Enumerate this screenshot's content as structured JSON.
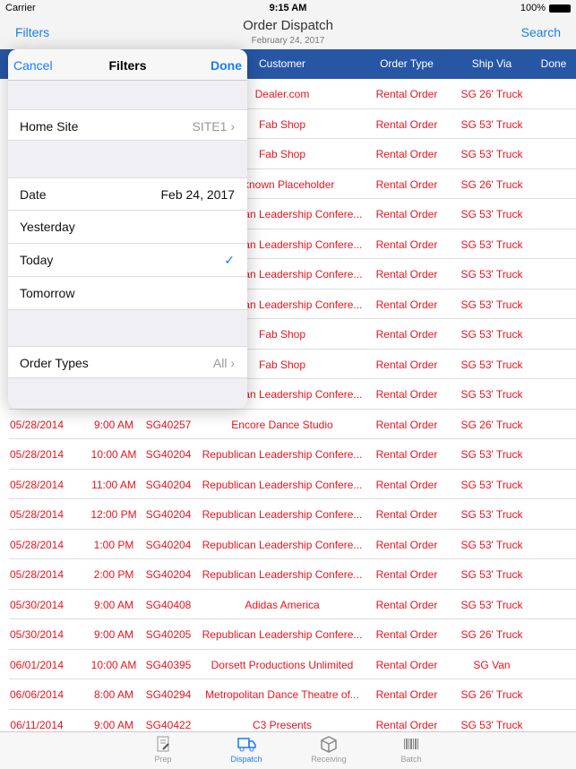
{
  "status": {
    "carrier": "Carrier",
    "time": "9:15 AM",
    "battery": "100%"
  },
  "nav": {
    "title": "Order Dispatch",
    "subtitle": "February 24, 2017",
    "filters": "Filters",
    "search": "Search"
  },
  "table": {
    "headers": [
      "Customer",
      "Order Type",
      "Ship Via",
      "Done"
    ],
    "rows": [
      [
        "",
        "",
        "",
        "Dealer.com",
        "Rental Order",
        "SG 26' Truck"
      ],
      [
        "",
        "",
        "",
        "Fab Shop",
        "Rental Order",
        "SG 53' Truck"
      ],
      [
        "",
        "",
        "",
        "Fab Shop",
        "Rental Order",
        "SG 53' Truck"
      ],
      [
        "",
        "",
        "",
        "Unknown Placeholder",
        "Rental Order",
        "SG 26' Truck"
      ],
      [
        "",
        "",
        "",
        "Republican Leadership Confere...",
        "Rental Order",
        "SG 53' Truck"
      ],
      [
        "",
        "",
        "",
        "Republican Leadership Confere...",
        "Rental Order",
        "SG 53' Truck"
      ],
      [
        "",
        "",
        "",
        "Republican Leadership Confere...",
        "Rental Order",
        "SG 53' Truck"
      ],
      [
        "",
        "",
        "",
        "Republican Leadership Confere...",
        "Rental Order",
        "SG 53' Truck"
      ],
      [
        "",
        "",
        "",
        "Fab Shop",
        "Rental Order",
        "SG 53' Truck"
      ],
      [
        "",
        "",
        "",
        "Fab Shop",
        "Rental Order",
        "SG 53' Truck"
      ],
      [
        "",
        "",
        "",
        "Republican Leadership Confere...",
        "Rental Order",
        "SG 53' Truck"
      ],
      [
        "05/28/2014",
        "9:00 AM",
        "SG40257",
        "Encore Dance Studio",
        "Rental Order",
        "SG 26' Truck"
      ],
      [
        "05/28/2014",
        "10:00 AM",
        "SG40204",
        "Republican Leadership Confere...",
        "Rental Order",
        "SG 53' Truck"
      ],
      [
        "05/28/2014",
        "11:00 AM",
        "SG40204",
        "Republican Leadership Confere...",
        "Rental Order",
        "SG 53' Truck"
      ],
      [
        "05/28/2014",
        "12:00 PM",
        "SG40204",
        "Republican Leadership Confere...",
        "Rental Order",
        "SG 53' Truck"
      ],
      [
        "05/28/2014",
        "1:00 PM",
        "SG40204",
        "Republican Leadership Confere...",
        "Rental Order",
        "SG 53' Truck"
      ],
      [
        "05/28/2014",
        "2:00 PM",
        "SG40204",
        "Republican Leadership Confere...",
        "Rental Order",
        "SG 53' Truck"
      ],
      [
        "05/30/2014",
        "9:00 AM",
        "SG40408",
        "Adidas America",
        "Rental Order",
        "SG 53' Truck"
      ],
      [
        "05/30/2014",
        "9:00 AM",
        "SG40205",
        "Republican Leadership Confere...",
        "Rental Order",
        "SG 26' Truck"
      ],
      [
        "06/01/2014",
        "10:00 AM",
        "SG40395",
        "Dorsett Productions Unlimited",
        "Rental Order",
        "SG Van"
      ],
      [
        "06/06/2014",
        "8:00 AM",
        "SG40294",
        "Metropolitan Dance Theatre of...",
        "Rental Order",
        "SG 26' Truck"
      ],
      [
        "06/11/2014",
        "9:00 AM",
        "SG40422",
        "C3 Presents",
        "Rental Order",
        "SG 53' Truck"
      ]
    ]
  },
  "filters": {
    "cancel": "Cancel",
    "title": "Filters",
    "done": "Done",
    "home_site_label": "Home Site",
    "home_site_value": "SITE1",
    "date_label": "Date",
    "date_value": "Feb 24, 2017",
    "yesterday": "Yesterday",
    "today": "Today",
    "tomorrow": "Tomorrow",
    "order_types_label": "Order Types",
    "order_types_value": "All",
    "selected": "Today"
  },
  "tabs": [
    {
      "label": "Prep",
      "icon": "notebook-icon"
    },
    {
      "label": "Dispatch",
      "icon": "truck-icon",
      "active": true
    },
    {
      "label": "Receiving",
      "icon": "box-icon"
    },
    {
      "label": "Batch",
      "icon": "barcode-icon"
    }
  ],
  "colors": {
    "accent": "#1a7cf5",
    "header": "#2756a5",
    "row_text": "#e8141e"
  }
}
